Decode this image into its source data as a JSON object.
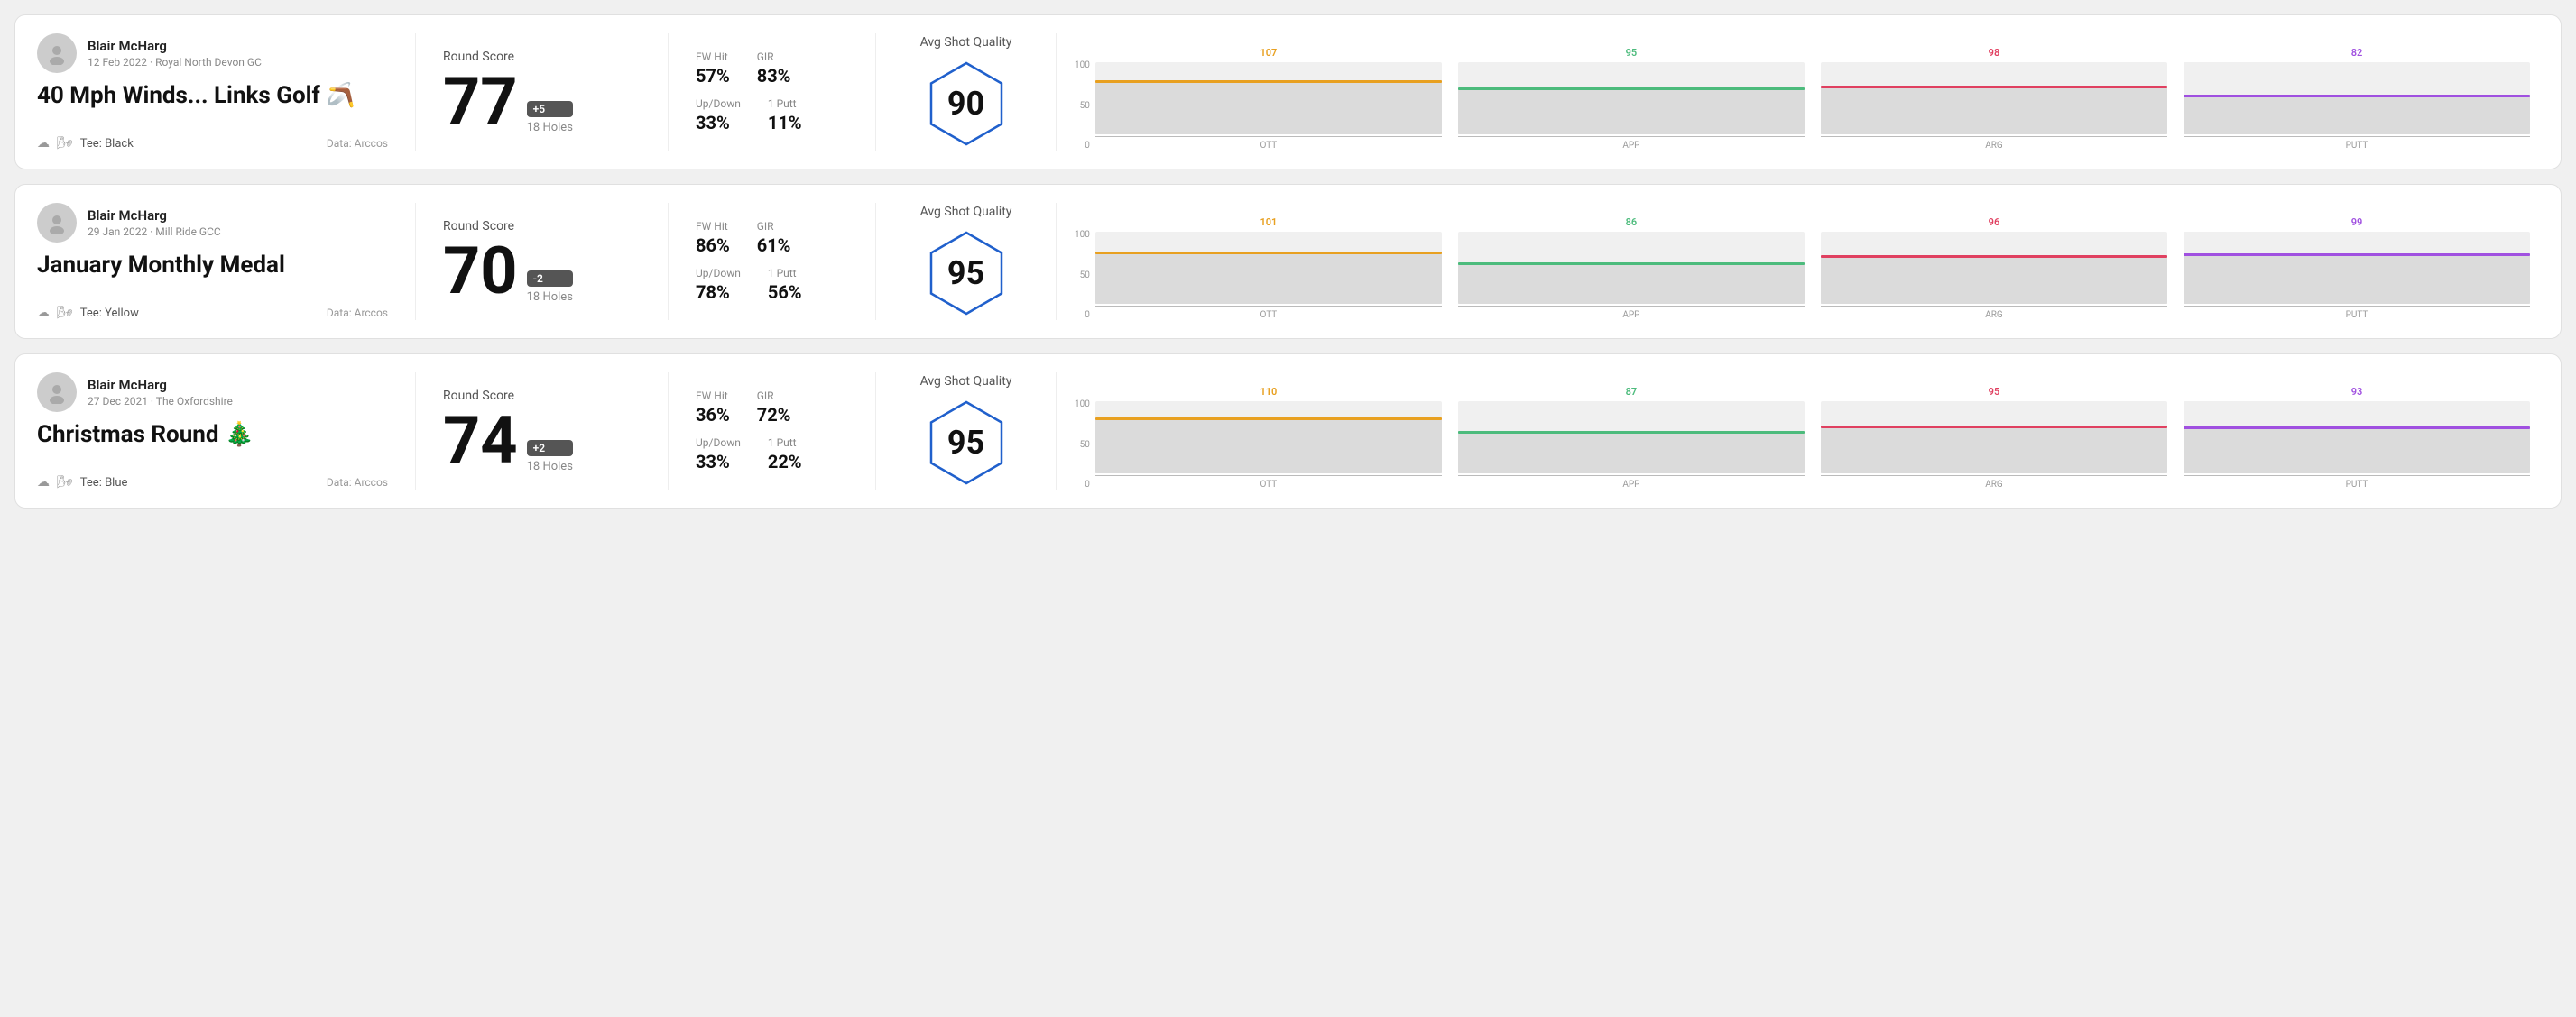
{
  "rounds": [
    {
      "id": "round1",
      "user": {
        "name": "Blair McHarg",
        "date_course": "12 Feb 2022 · Royal North Devon GC"
      },
      "title": "40 Mph Winds... Links Golf",
      "title_emoji": "🪃",
      "tee": "Black",
      "data_source": "Data: Arccos",
      "round_score_label": "Round Score",
      "score": "77",
      "score_diff": "+5",
      "holes": "18 Holes",
      "fw_hit_label": "FW Hit",
      "fw_hit_value": "57%",
      "gir_label": "GIR",
      "gir_value": "83%",
      "updown_label": "Up/Down",
      "updown_value": "33%",
      "one_putt_label": "1 Putt",
      "one_putt_value": "11%",
      "quality_label": "Avg Shot Quality",
      "quality_score": "90",
      "chart": {
        "columns": [
          {
            "label": "OTT",
            "value": 107,
            "color": "#e8a020",
            "pct": 75
          },
          {
            "label": "APP",
            "value": 95,
            "color": "#4cbb7c",
            "pct": 65
          },
          {
            "label": "ARG",
            "value": 98,
            "color": "#e04060",
            "pct": 68
          },
          {
            "label": "PUTT",
            "value": 82,
            "color": "#a050e0",
            "pct": 55
          }
        ]
      }
    },
    {
      "id": "round2",
      "user": {
        "name": "Blair McHarg",
        "date_course": "29 Jan 2022 · Mill Ride GCC"
      },
      "title": "January Monthly Medal",
      "title_emoji": "",
      "tee": "Yellow",
      "data_source": "Data: Arccos",
      "round_score_label": "Round Score",
      "score": "70",
      "score_diff": "-2",
      "holes": "18 Holes",
      "fw_hit_label": "FW Hit",
      "fw_hit_value": "86%",
      "gir_label": "GIR",
      "gir_value": "61%",
      "updown_label": "Up/Down",
      "updown_value": "78%",
      "one_putt_label": "1 Putt",
      "one_putt_value": "56%",
      "quality_label": "Avg Shot Quality",
      "quality_score": "95",
      "chart": {
        "columns": [
          {
            "label": "OTT",
            "value": 101,
            "color": "#e8a020",
            "pct": 72
          },
          {
            "label": "APP",
            "value": 86,
            "color": "#4cbb7c",
            "pct": 58
          },
          {
            "label": "ARG",
            "value": 96,
            "color": "#e04060",
            "pct": 67
          },
          {
            "label": "PUTT",
            "value": 99,
            "color": "#a050e0",
            "pct": 70
          }
        ]
      }
    },
    {
      "id": "round3",
      "user": {
        "name": "Blair McHarg",
        "date_course": "27 Dec 2021 · The Oxfordshire"
      },
      "title": "Christmas Round",
      "title_emoji": "🎄",
      "tee": "Blue",
      "data_source": "Data: Arccos",
      "round_score_label": "Round Score",
      "score": "74",
      "score_diff": "+2",
      "holes": "18 Holes",
      "fw_hit_label": "FW Hit",
      "fw_hit_value": "36%",
      "gir_label": "GIR",
      "gir_value": "72%",
      "updown_label": "Up/Down",
      "updown_value": "33%",
      "one_putt_label": "1 Putt",
      "one_putt_value": "22%",
      "quality_label": "Avg Shot Quality",
      "quality_score": "95",
      "chart": {
        "columns": [
          {
            "label": "OTT",
            "value": 110,
            "color": "#e8a020",
            "pct": 78
          },
          {
            "label": "APP",
            "value": 87,
            "color": "#4cbb7c",
            "pct": 59
          },
          {
            "label": "ARG",
            "value": 95,
            "color": "#e04060",
            "pct": 66
          },
          {
            "label": "PUTT",
            "value": 93,
            "color": "#a050e0",
            "pct": 65
          }
        ]
      }
    }
  ],
  "labels": {
    "y_axis": [
      "100",
      "50",
      "0"
    ]
  }
}
